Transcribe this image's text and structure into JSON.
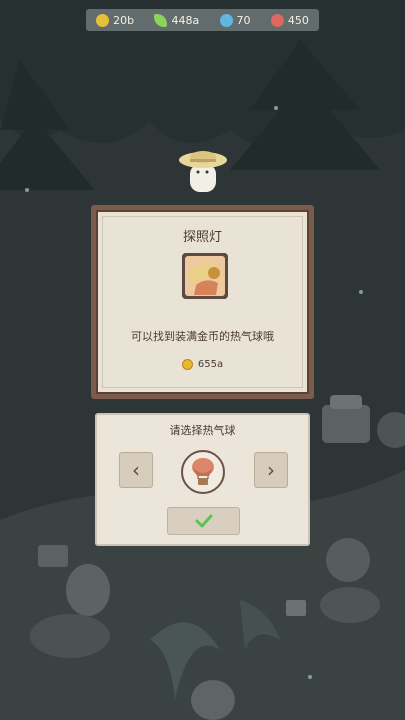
{
  "resources": [
    {
      "icon": "gold-coin-icon",
      "value": "20b",
      "color": "#e7c03a"
    },
    {
      "icon": "green-leaf-icon",
      "value": "448a",
      "color": "#8fd45a"
    },
    {
      "icon": "blue-crystal-icon",
      "value": "70",
      "color": "#5fb8e0"
    },
    {
      "icon": "red-heart-icon",
      "value": "450",
      "color": "#e0675f"
    }
  ],
  "item_panel": {
    "title": "探照灯",
    "description": "可以找到装满金币的热气球哦",
    "price": "655a"
  },
  "select_panel": {
    "title": "请选择热气球",
    "prev_label": "‹",
    "next_label": "›"
  }
}
